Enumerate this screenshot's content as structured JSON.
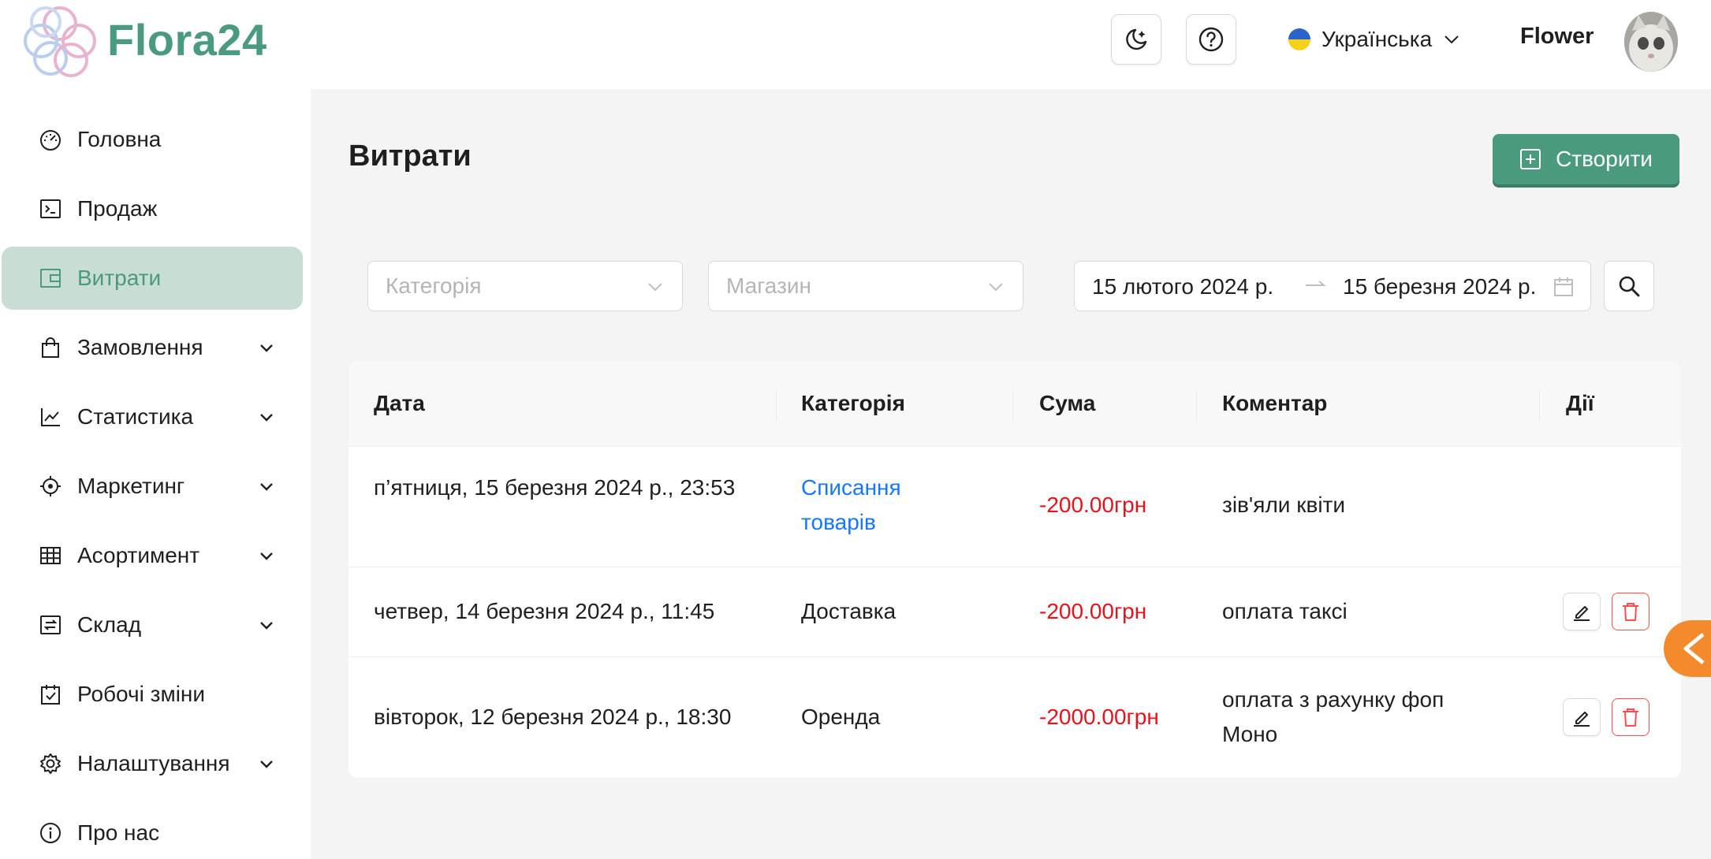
{
  "app": {
    "name": "Flora24"
  },
  "header": {
    "theme_icon": "moon-star-icon",
    "help_icon": "question-circle-icon",
    "language": "Українська",
    "user_name": "Flower"
  },
  "sidebar": {
    "items": [
      {
        "label": "Головна",
        "icon": "dashboard-icon",
        "has_submenu": false,
        "active": false
      },
      {
        "label": "Продаж",
        "icon": "terminal-icon",
        "has_submenu": false,
        "active": false
      },
      {
        "label": "Витрати",
        "icon": "wallet-icon",
        "has_submenu": false,
        "active": true
      },
      {
        "label": "Замовлення",
        "icon": "shopping-bag-icon",
        "has_submenu": true,
        "active": false
      },
      {
        "label": "Статистика",
        "icon": "line-chart-icon",
        "has_submenu": true,
        "active": false
      },
      {
        "label": "Маркетинг",
        "icon": "aim-icon",
        "has_submenu": true,
        "active": false
      },
      {
        "label": "Асортимент",
        "icon": "table-icon",
        "has_submenu": true,
        "active": false
      },
      {
        "label": "Склад",
        "icon": "swap-icon",
        "has_submenu": true,
        "active": false
      },
      {
        "label": "Робочі зміни",
        "icon": "calendar-check-icon",
        "has_submenu": false,
        "active": false
      },
      {
        "label": "Налаштування",
        "icon": "gear-icon",
        "has_submenu": true,
        "active": false
      },
      {
        "label": "Про нас",
        "icon": "info-circle-icon",
        "has_submenu": false,
        "active": false
      }
    ]
  },
  "main": {
    "title": "Витрати",
    "create_label": "Створити",
    "filters": {
      "category_placeholder": "Категорія",
      "shop_placeholder": "Магазин",
      "date_from": "15 лютого 2024 р.",
      "date_to": "15 березня 2024 р."
    },
    "table": {
      "columns": [
        "Дата",
        "Категорія",
        "Сума",
        "Коментар",
        "Дії"
      ],
      "rows": [
        {
          "date": "п’ятниця, 15 березня 2024 р., 23:53",
          "category": "Списання товарів",
          "category_link": true,
          "amount": "-200.00грн",
          "comment": "зів'яли квіти",
          "actions": false
        },
        {
          "date": "четвер, 14 березня 2024 р., 11:45",
          "category": "Доставка",
          "category_link": false,
          "amount": "-200.00грн",
          "comment": "оплата таксі",
          "actions": true
        },
        {
          "date": "вівторок, 12 березня 2024 р., 18:30",
          "category": "Оренда",
          "category_link": false,
          "amount": "-2000.00грн",
          "comment": "оплата з рахунку фоп Моно",
          "actions": true
        }
      ]
    }
  },
  "colors": {
    "brand": "#4a9a7e",
    "active_nav_bg": "#c8ddd3",
    "negative": "#e8131a",
    "link": "#1677ff",
    "float_tab": "#f58a2d"
  }
}
